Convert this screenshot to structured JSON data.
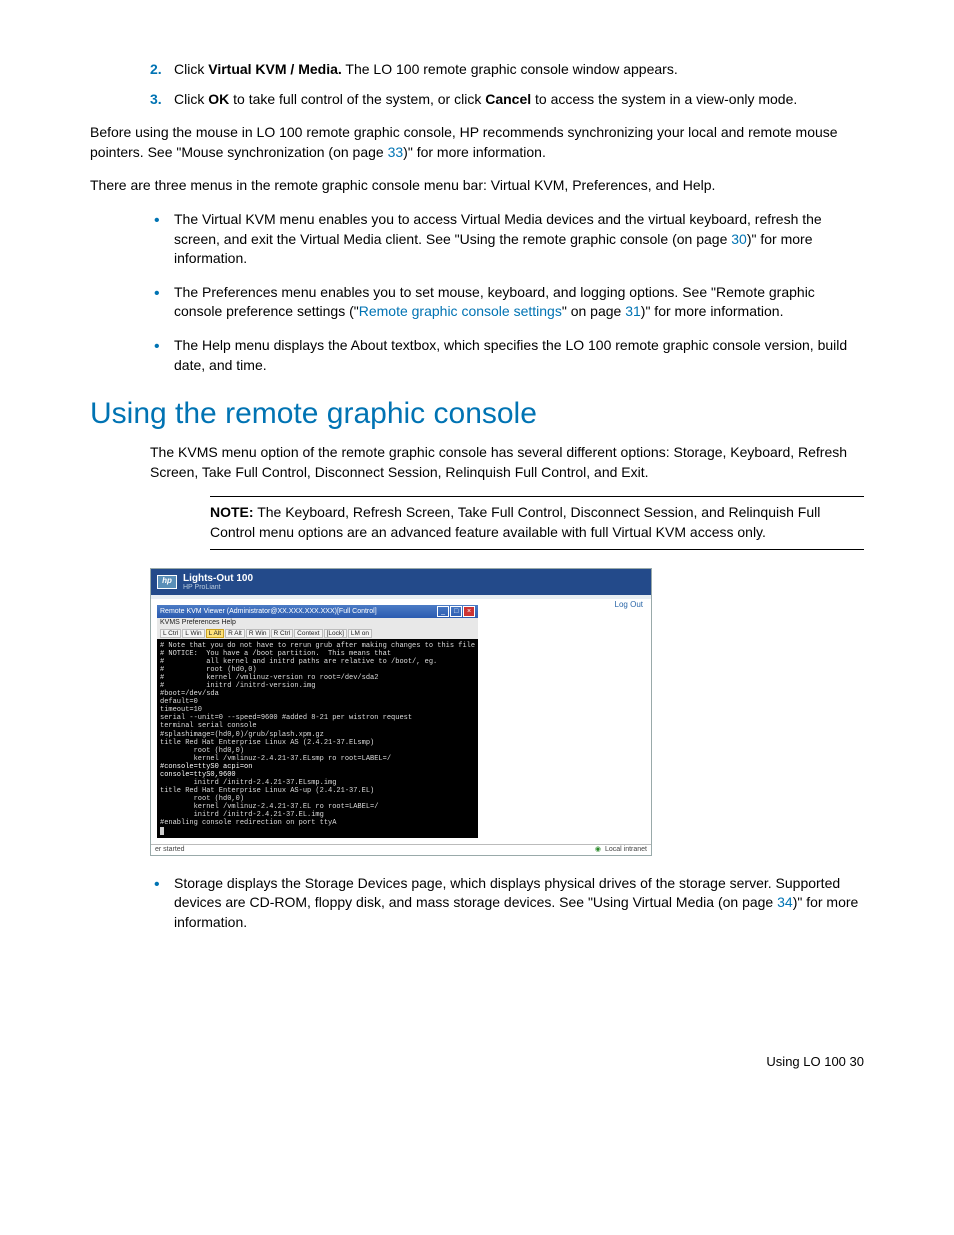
{
  "steps": {
    "s2_num": "2.",
    "s2_pre": "Click ",
    "s2_bold": "Virtual KVM / Media.",
    "s2_post": " The LO 100 remote graphic console window appears.",
    "s3_num": "3.",
    "s3_pre": "Click ",
    "s3_bold1": "OK",
    "s3_mid": " to take full control of the system, or click ",
    "s3_bold2": "Cancel",
    "s3_post": " to access the system in a view-only mode."
  },
  "para1_pre": "Before using the mouse in LO 100 remote graphic console, HP recommends synchronizing your local and remote mouse pointers. See \"Mouse synchronization (on page ",
  "para1_link": "33",
  "para1_post": ")\" for more information.",
  "para2": "There are three menus in the remote graphic console menu bar: Virtual KVM, Preferences, and Help.",
  "menubullets": {
    "b1_pre": "The Virtual KVM menu enables you to access Virtual Media devices and the virtual keyboard, refresh the screen, and exit the Virtual Media client. See \"Using the remote graphic console (on page ",
    "b1_link": "30",
    "b1_post": ")\" for more information.",
    "b2_pre": "The Preferences menu enables you to set mouse, keyboard, and logging options. See \"Remote graphic console preference settings (\"",
    "b2_link": "Remote graphic console settings",
    "b2_mid": "\" on page ",
    "b2_link2": "31",
    "b2_post": ")\" for more information.",
    "b3": "The Help menu displays the About textbox, which specifies the LO 100 remote graphic console version, build date, and time."
  },
  "section_heading": "Using the remote graphic console",
  "section_para": "The KVMS menu option of the remote graphic console has several different options: Storage, Keyboard, Refresh Screen, Take Full Control, Disconnect Session, Relinquish Full Control, and Exit.",
  "note_label": "NOTE:",
  "note_text": "  The Keyboard, Refresh Screen, Take Full Control, Disconnect Session, and Relinquish Full Control menu options are an advanced feature available with full Virtual KVM access only.",
  "screenshot": {
    "app_title": "Lights-Out 100",
    "app_sub": "HP ProLiant",
    "logout": "Log Out",
    "inner_title": "Remote KVM Viewer (Administrator@XX.XXX.XXX.XXX)[Full Control]",
    "menus": "KVMS   Preferences   Help",
    "toolbar": [
      "L Ctrl",
      "L Win",
      "L Alt",
      "R Alt",
      "R Win",
      "R Ctrl",
      "Context",
      "[Lock]",
      "LM on"
    ],
    "toolbar_highlight_index": 2,
    "console_text": "# Note that you do not have to rerun grub after making changes to this file\n# NOTICE:  You have a /boot partition.  This means that\n#          all kernel and initrd paths are relative to /boot/, eg.\n#          root (hd0,0)\n#          kernel /vmlinuz-version ro root=/dev/sda2\n#          initrd /initrd-version.img\n#boot=/dev/sda\ndefault=0\ntimeout=10\nserial --unit=0 --speed=9600 #added 8-21 per wistron request\nterminal serial console\n#splashimage=(hd0,0)/grub/splash.xpm.gz\ntitle Red Hat Enterprise Linux AS (2.4.21-37.ELsmp)\n        root (hd0,0)\n        kernel /vmlinuz-2.4.21-37.ELsmp ro root=LABEL=/\n#console=ttyS0 acpi=on\nconsole=ttyS0,9600\n        initrd /initrd-2.4.21-37.ELsmp.img\ntitle Red Hat Enterprise Linux AS-up (2.4.21-37.EL)\n        root (hd0,0)\n        kernel /vmlinuz-2.4.21-37.EL ro root=LABEL=/\n        initrd /initrd-2.4.21-37.EL.img\n\n#enabling console redirection on port ttyA",
    "status_left": "er started",
    "status_right": "Local intranet"
  },
  "after_bullet_pre": "Storage displays the Storage Devices page, which displays physical drives of the storage server. Supported devices are CD-ROM, floppy disk, and mass storage devices. See \"Using Virtual Media (on page ",
  "after_bullet_link": "34",
  "after_bullet_post": ")\" for more information.",
  "footer": "Using LO 100   30"
}
